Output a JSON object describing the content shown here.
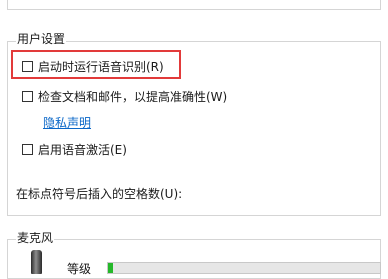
{
  "user_settings": {
    "title": "用户设置",
    "options": [
      {
        "label": "启动时运行语音识别(R)",
        "checked": false
      },
      {
        "label": "检查文档和邮件，以提高准确性(W)",
        "checked": false
      },
      {
        "label": "启用语音激活(E)",
        "checked": false
      }
    ],
    "privacy_link": "隐私声明",
    "spaces_label": "在标点符号后插入的空格数(U):"
  },
  "microphone": {
    "title": "麦克风",
    "level_label": "等级",
    "level_fraction": 0.02
  },
  "colors": {
    "highlight_border": "#e23a3a",
    "link": "#0a67c8",
    "level_fill": "#25b82a"
  },
  "icons": {
    "microphone": "microphone-icon"
  }
}
